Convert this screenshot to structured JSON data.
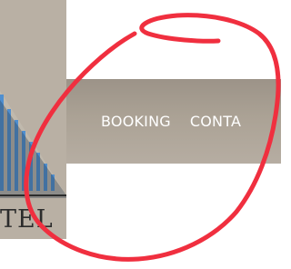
{
  "logo": {
    "text": "TEL",
    "colors": {
      "panel": "#b9b0a4",
      "bars": "#4f8fd0",
      "text": "#2c2c2c"
    }
  },
  "nav": {
    "items": [
      {
        "label": "BOOKING"
      },
      {
        "label": "CONTA"
      }
    ],
    "text_color": "#ffffff",
    "background": "#aca396"
  },
  "annotation": {
    "color": "#f02f3f",
    "shape": "hand-drawn-circle"
  }
}
